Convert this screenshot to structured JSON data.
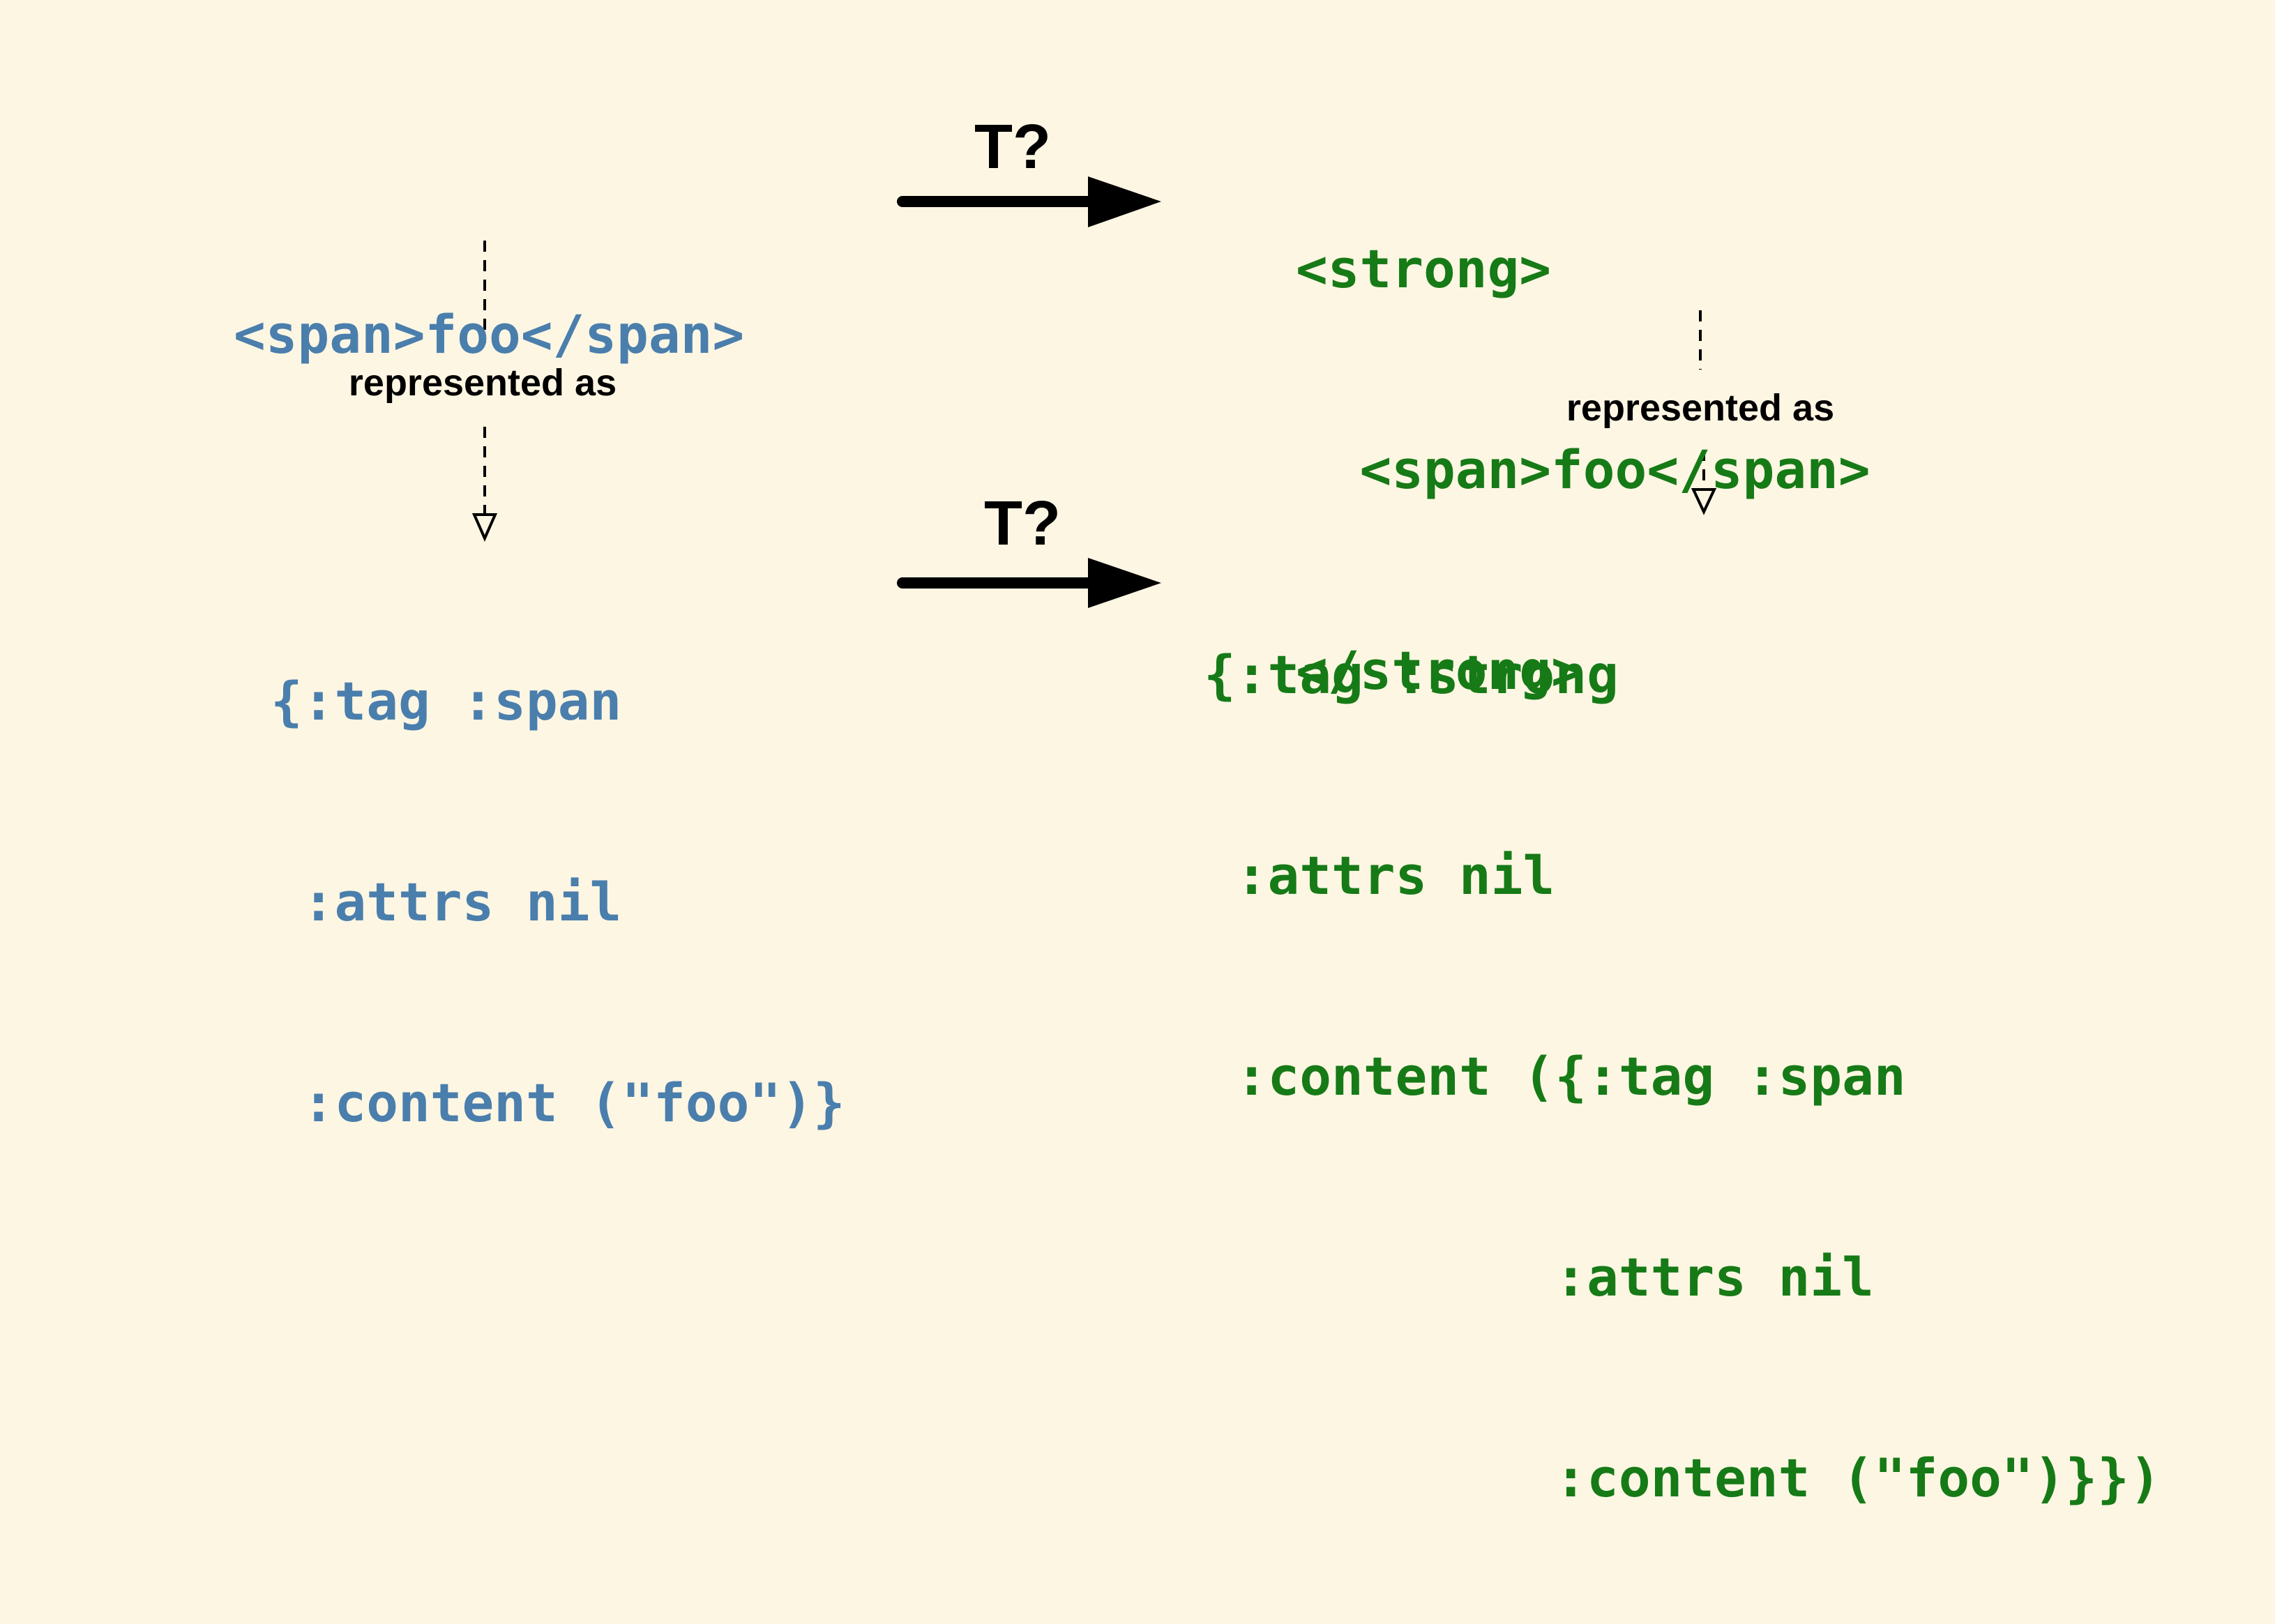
{
  "left_html": [
    "<span>foo</span>"
  ],
  "left_map": [
    "{:tag :span",
    " :attrs nil",
    " :content (\"foo\")}"
  ],
  "right_html": [
    "<strong>",
    "  <span>foo</span>",
    "</strong>"
  ],
  "right_map": [
    "{:tag :strong",
    " :attrs nil",
    " :content ({:tag :span",
    "           :attrs nil",
    "           :content (\"foo\")}})"
  ],
  "labels": {
    "represented_as": "represented as",
    "transform": "T?"
  },
  "colors": {
    "background": "#fdf6e3",
    "input": "#4a7eac",
    "output": "#167a16",
    "arrow": "#000000"
  }
}
